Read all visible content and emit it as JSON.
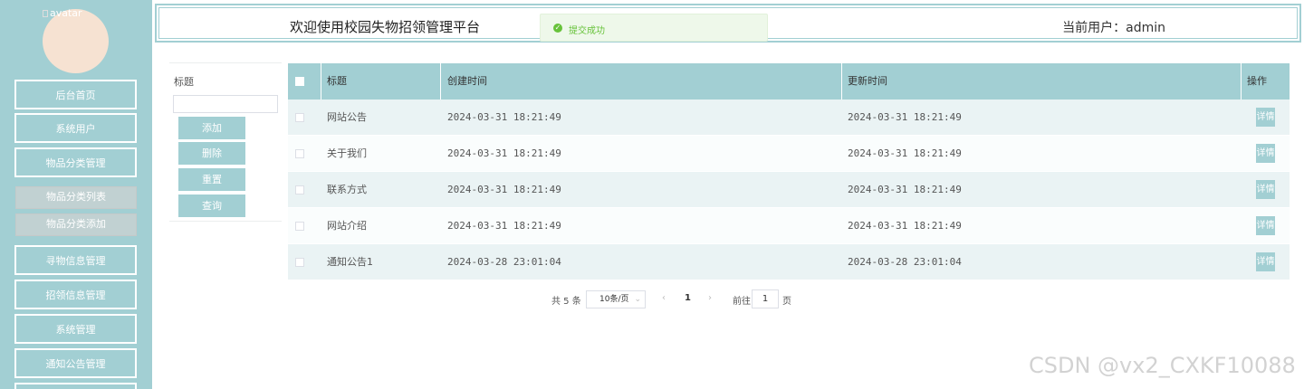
{
  "sidebar": {
    "avatar_alt": "avatar",
    "menu": [
      {
        "label": "后台首页"
      },
      {
        "label": "系统用户"
      },
      {
        "label": "物品分类管理"
      },
      {
        "label": "物品分类列表"
      },
      {
        "label": "物品分类添加"
      },
      {
        "label": "寻物信息管理"
      },
      {
        "label": "招领信息管理"
      },
      {
        "label": "系统管理"
      },
      {
        "label": "通知公告管理"
      }
    ]
  },
  "header": {
    "title": "欢迎使用校园失物招领管理平台",
    "user_label": "当前用户：admin"
  },
  "toast": {
    "icon": "check-icon",
    "text": "提交成功"
  },
  "search": {
    "label": "标题",
    "input_value": "",
    "buttons": {
      "add": "添加",
      "delete": "删除",
      "reset": "重置",
      "query": "查询"
    }
  },
  "table": {
    "headers": {
      "title": "标题",
      "created": "创建时间",
      "updated": "更新时间",
      "op": "操作"
    },
    "rows": [
      {
        "title": "网站公告",
        "created": "2024-03-31 18:21:49",
        "updated": "2024-03-31 18:21:49",
        "action": "详情"
      },
      {
        "title": "关于我们",
        "created": "2024-03-31 18:21:49",
        "updated": "2024-03-31 18:21:49",
        "action": "详情"
      },
      {
        "title": "联系方式",
        "created": "2024-03-31 18:21:49",
        "updated": "2024-03-31 18:21:49",
        "action": "详情"
      },
      {
        "title": "网站介绍",
        "created": "2024-03-31 18:21:49",
        "updated": "2024-03-31 18:21:49",
        "action": "详情"
      },
      {
        "title": "通知公告1",
        "created": "2024-03-28 23:01:04",
        "updated": "2024-03-28 23:01:04",
        "action": "详情"
      }
    ]
  },
  "pagination": {
    "total": "共 5 条",
    "page_size": "10条/页",
    "current_page": "1",
    "goto_label": "前往",
    "goto_value": "1",
    "unit": "页"
  },
  "watermark": "CSDN @vx2_CXKF10088",
  "colors": {
    "accent": "#a2cfd3",
    "toast_bg": "#eef8ea",
    "toast_text": "#67c23a"
  }
}
